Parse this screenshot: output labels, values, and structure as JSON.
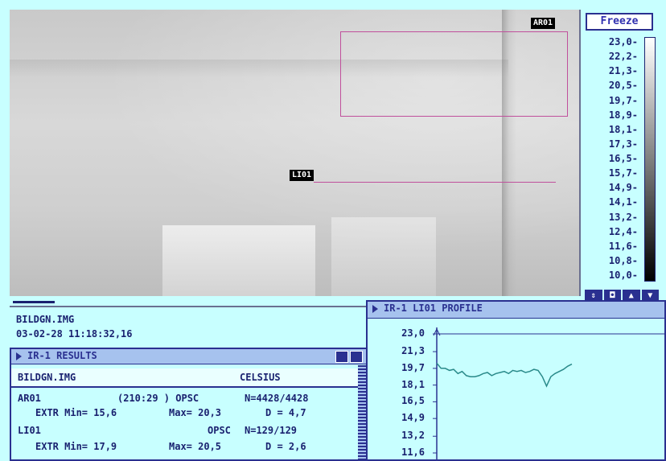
{
  "image": {
    "ar_tag": "AR01",
    "li_tag": "LI01"
  },
  "scale": {
    "freeze_label": "Freeze",
    "labels": [
      "23,0",
      "22,2",
      "21,3",
      "20,5",
      "19,7",
      "18,9",
      "18,1",
      "17,3",
      "16,5",
      "15,7",
      "14,9",
      "14,1",
      "13,2",
      "12,4",
      "11,6",
      "10,8",
      "10,0"
    ],
    "controls": [
      "⇕",
      "◘",
      "▲",
      "▼"
    ]
  },
  "info": {
    "filename": "BILDGN.IMG",
    "datetime": "03-02-28 11:18:32,16"
  },
  "results": {
    "title": "IR-1 RESULTS",
    "header_file": "BILDGN.IMG",
    "header_unit": "CELSIUS",
    "rows": [
      {
        "name": "AR01",
        "mid": "(210:29 ) OPSC",
        "count": "N=4428/4428"
      },
      {
        "name": "",
        "mid": "EXTR Min= 15,6",
        "count": "Max= 20,3",
        "delta": "D = 4,7"
      },
      {
        "name": "LI01",
        "mid": "OPSC",
        "count": "N=129/129"
      },
      {
        "name": "",
        "mid": "EXTR Min= 17,9",
        "count": "Max= 20,5",
        "delta": "D = 2,6"
      }
    ]
  },
  "profile": {
    "title": "IR-1 LI01 PROFILE",
    "y_labels": [
      "23,0",
      "21,3",
      "19,7",
      "18,1",
      "16,5",
      "14,9",
      "13,2",
      "11,6"
    ]
  },
  "chart_data": {
    "type": "line",
    "title": "IR-1 LI01 PROFILE",
    "xlabel": "",
    "ylabel": "",
    "ylim": [
      11.6,
      23.0
    ],
    "y_ticks": [
      23.0,
      21.3,
      19.7,
      18.1,
      16.5,
      14.9,
      13.2,
      11.6
    ],
    "x": [
      0,
      4,
      8,
      12,
      16,
      20,
      24,
      28,
      32,
      36,
      40,
      44,
      48,
      52,
      56,
      60,
      64,
      68,
      72,
      76,
      80,
      84,
      88,
      92,
      96,
      100,
      104,
      108,
      112,
      116,
      120,
      124,
      128
    ],
    "values": [
      20.2,
      19.7,
      19.7,
      19.5,
      19.6,
      19.2,
      19.4,
      19.0,
      18.9,
      18.9,
      19.0,
      19.2,
      19.3,
      19.0,
      19.2,
      19.3,
      19.4,
      19.2,
      19.5,
      19.4,
      19.5,
      19.3,
      19.4,
      19.6,
      19.5,
      18.9,
      18.0,
      18.9,
      19.2,
      19.4,
      19.6,
      19.9,
      20.1
    ]
  }
}
